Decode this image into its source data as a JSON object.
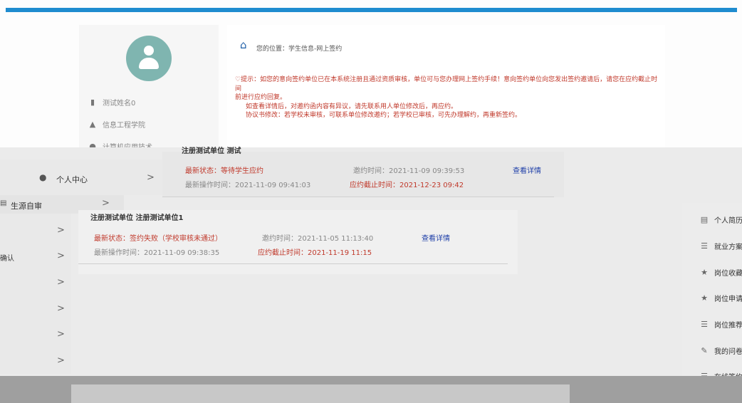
{
  "profile": {
    "name": "测试姓名0",
    "college": "信息工程学院",
    "major": "计算机应用技术"
  },
  "breadcrumb": "您的位置：学生信息-网上签约",
  "notice": {
    "line1": "提示：如您的意向签约单位已在本系统注册且通过资质审核，单位可与您办理网上签约手续！意向签约单位向您发出签约邀请后，请您在应约截止时间",
    "line2": "前进行应约回复。",
    "line3": "如查看详情后，对邀约函内容有异议，请先联系用人单位修改后，再应约。",
    "line4": "协议书修改：若学校未审核，可联系单位修改邀约；若学校已审核，可先办理解约，再重新签约。"
  },
  "nav": {
    "personal_center": "个人中心",
    "source_check": "生源自审",
    "confirm_partial": "确认"
  },
  "records": [
    {
      "company": "注册测试单位 测试",
      "status": "最新状态：等待学生应约",
      "invite_time": "邀约时间：2021-11-09 09:39:53",
      "detail": "查看详情",
      "last_op": "最新操作时间：2021-11-09 09:41:03",
      "deadline": "应约截止时间：2021-12-23 09:42"
    },
    {
      "company": "注册测试单位 注册测试单位1",
      "status": "最新状态：签约失败（学校审核未通过）",
      "invite_time": "邀约时间：2021-11-05 11:13:40",
      "detail": "查看详情",
      "last_op": "最新操作时间：2021-11-09 09:38:35",
      "deadline": "应约截止时间：2021-11-19 11:15"
    }
  ],
  "right_nav": [
    "个人简历",
    "就业方案",
    "岗位收藏",
    "岗位申请",
    "岗位推荐",
    "我的问卷",
    "在线签约"
  ]
}
